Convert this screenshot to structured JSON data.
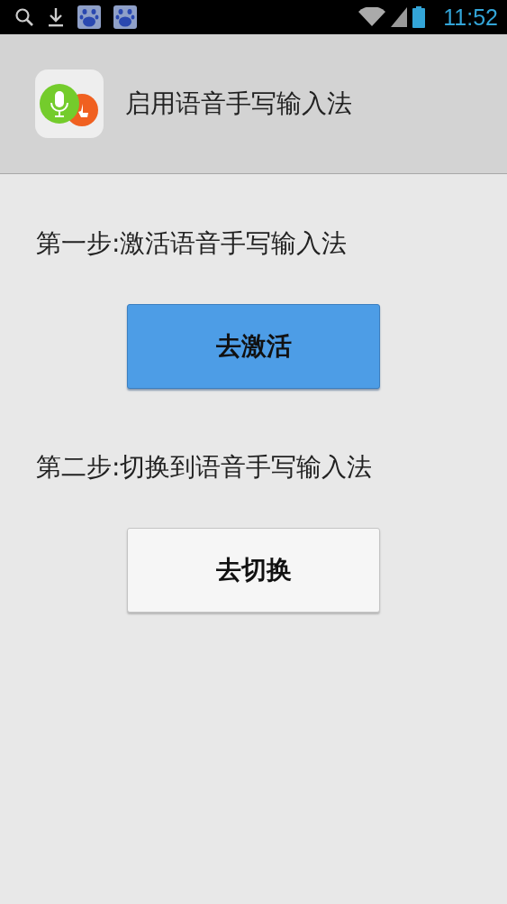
{
  "status_bar": {
    "time": "11:52"
  },
  "header": {
    "title": "启用语音手写输入法"
  },
  "steps": [
    {
      "text": "第一步:激活语音手写输入法",
      "button": {
        "label": "去激活",
        "kind": "primary"
      }
    },
    {
      "text": "第二步:切换到语音手写输入法",
      "button": {
        "label": "去切换",
        "kind": "default"
      }
    }
  ]
}
